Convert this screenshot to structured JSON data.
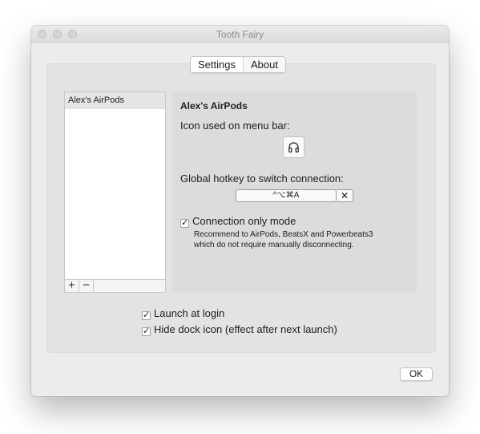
{
  "window": {
    "title": "Tooth Fairy"
  },
  "tabs": [
    {
      "label": "Settings",
      "selected": true
    },
    {
      "label": "About",
      "selected": false
    }
  ],
  "device_list": {
    "items": [
      "Alex's AirPods"
    ],
    "add_label": "+",
    "remove_label": "−"
  },
  "details": {
    "device_name": "Alex's AirPods",
    "icon_label": "Icon used on menu bar:",
    "icon": "headphones-icon",
    "hotkey_label": "Global hotkey to switch connection:",
    "hotkey_value": "^⌥⌘A",
    "hotkey_clear": "✕",
    "connection_only_label": "Connection only mode",
    "connection_only_checked": true,
    "connection_desc_line1": "Recommend to AirPods, BeatsX and Powerbeats3",
    "connection_desc_line2": "which do not require manually disconnecting."
  },
  "options": {
    "launch_at_login_label": "Launch at login",
    "launch_at_login_checked": true,
    "hide_dock_label": "Hide dock icon (effect after next launch)",
    "hide_dock_checked": true
  },
  "footer": {
    "ok_label": "OK"
  },
  "checkmark": "✓"
}
